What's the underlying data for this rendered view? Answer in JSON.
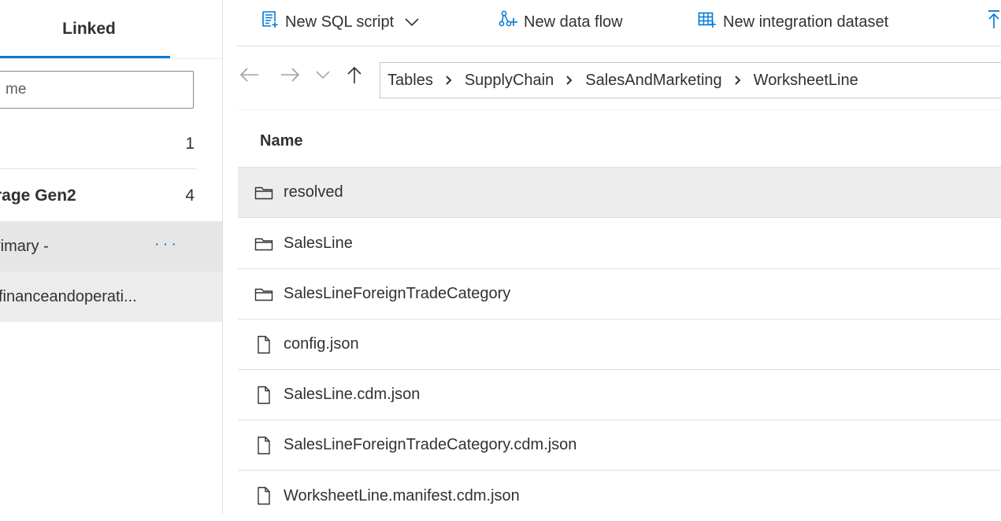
{
  "left_panel": {
    "tab_label": "Linked",
    "filter_placeholder": "me",
    "groups": [
      {
        "name": "",
        "count": "1"
      },
      {
        "name": "rage Gen2",
        "count": "4"
      }
    ],
    "tree_items": [
      {
        "label": "rimary -",
        "more": "···"
      },
      {
        "label": "financeandoperati..."
      }
    ]
  },
  "toolbar": {
    "new_sql_script": "New SQL script",
    "new_data_flow": "New data flow",
    "new_integration_dataset": "New integration dataset"
  },
  "breadcrumb": [
    "Tables",
    "SupplyChain",
    "SalesAndMarketing",
    "WorksheetLine"
  ],
  "file_list": {
    "column_header": "Name",
    "items": [
      {
        "name": "resolved",
        "type": "folder",
        "icon": "folder-icon",
        "selected": true
      },
      {
        "name": "SalesLine",
        "type": "folder",
        "icon": "folder-icon"
      },
      {
        "name": "SalesLineForeignTradeCategory",
        "type": "folder",
        "icon": "folder-icon"
      },
      {
        "name": "config.json",
        "type": "file",
        "icon": "file-icon"
      },
      {
        "name": "SalesLine.cdm.json",
        "type": "file",
        "icon": "file-icon"
      },
      {
        "name": "SalesLineForeignTradeCategory.cdm.json",
        "type": "file",
        "icon": "file-icon"
      },
      {
        "name": "WorksheetLine.manifest.cdm.json",
        "type": "file",
        "icon": "file-icon"
      }
    ]
  },
  "colors": {
    "accent": "#0078d4",
    "selected_row": "#ededed",
    "text": "#323130"
  }
}
